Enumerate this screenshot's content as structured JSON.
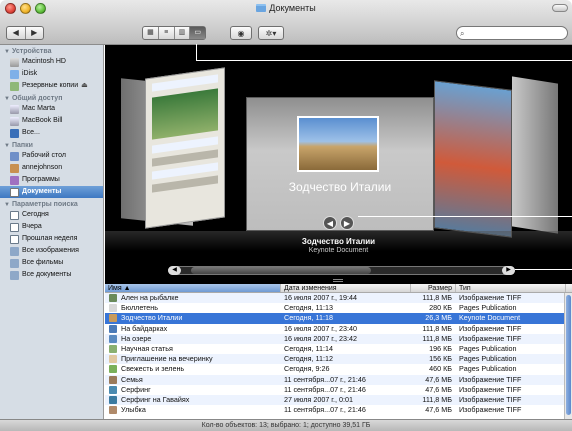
{
  "window": {
    "title": "Документы"
  },
  "toolbar": {
    "back": "◀",
    "forward": "▶",
    "views": [
      "▦",
      "≡",
      "▥",
      "▭"
    ],
    "eye": "◉",
    "gear": "✲▾",
    "search_placeholder": ""
  },
  "sidebar": {
    "sections": [
      {
        "title": "Устройства",
        "items": [
          {
            "label": "Macintosh HD",
            "icon": "hard-drive-icon"
          },
          {
            "label": "iDisk",
            "icon": "idisk-icon"
          },
          {
            "label": "Резервные копии",
            "icon": "time-machine-icon",
            "eject": "⏏"
          }
        ]
      },
      {
        "title": "Общий доступ",
        "items": [
          {
            "label": "Mac Marta",
            "icon": "computer-icon"
          },
          {
            "label": "MacBook Bill",
            "icon": "laptop-icon"
          },
          {
            "label": "Все...",
            "icon": "globe-icon"
          }
        ]
      },
      {
        "title": "Папки",
        "items": [
          {
            "label": "Рабочий стол",
            "icon": "desktop-icon"
          },
          {
            "label": "annejohnson",
            "icon": "home-icon"
          },
          {
            "label": "Программы",
            "icon": "applications-icon"
          },
          {
            "label": "Документы",
            "icon": "documents-icon",
            "selected": true
          }
        ]
      },
      {
        "title": "Параметры поиска",
        "items": [
          {
            "label": "Сегодня",
            "icon": "clock-icon"
          },
          {
            "label": "Вчера",
            "icon": "clock-icon"
          },
          {
            "label": "Прошлая неделя",
            "icon": "clock-icon"
          },
          {
            "label": "Все изображения",
            "icon": "smart-folder-icon"
          },
          {
            "label": "Все фильмы",
            "icon": "smart-folder-icon"
          },
          {
            "label": "Все документы",
            "icon": "smart-folder-icon"
          }
        ]
      }
    ]
  },
  "coverflow": {
    "center_title": "Зодчество Италии",
    "selected_name": "Зодчество Италии",
    "selected_kind": "Keynote Document",
    "prev": "◀",
    "next": "▶"
  },
  "list": {
    "columns": {
      "name": "Имя",
      "date": "Дата изменения",
      "size": "Размер",
      "type": "Тип"
    },
    "rows": [
      {
        "name": "Ален на рыбалке",
        "date": "16 июля 2007 г., 19:44",
        "size": "111,8 МБ",
        "type": "Изображение TIFF",
        "color": "#6a8a5a"
      },
      {
        "name": "Бюллетень",
        "date": "Сегодня, 11:13",
        "size": "280 КБ",
        "type": "Pages Publication",
        "color": "#d8d8d8"
      },
      {
        "name": "Зодчество Италии",
        "date": "Сегодня, 11:18",
        "size": "26,3 МБ",
        "type": "Keynote Document",
        "color": "#c89a5a",
        "selected": true
      },
      {
        "name": "На байдарках",
        "date": "16 июля 2007 г., 23:40",
        "size": "111,8 МБ",
        "type": "Изображение TIFF",
        "color": "#4a7ab8"
      },
      {
        "name": "На озере",
        "date": "16 июля 2007 г., 23:42",
        "size": "111,8 МБ",
        "type": "Изображение TIFF",
        "color": "#5a8ac0"
      },
      {
        "name": "Научная статья",
        "date": "Сегодня, 11:14",
        "size": "196 КБ",
        "type": "Pages Publication",
        "color": "#8ab070"
      },
      {
        "name": "Приглашение на вечеринку",
        "date": "Сегодня, 11:12",
        "size": "156 КБ",
        "type": "Pages Publication",
        "color": "#e0c8a0"
      },
      {
        "name": "Свежесть и зелень",
        "date": "Сегодня, 9:26",
        "size": "460 КБ",
        "type": "Pages Publication",
        "color": "#7ab05a"
      },
      {
        "name": "Семья",
        "date": "11 сентября...07 г., 21:46",
        "size": "47,6 МБ",
        "type": "Изображение TIFF",
        "color": "#9a7a5a"
      },
      {
        "name": "Серфинг",
        "date": "11 сентября...07 г., 21:46",
        "size": "47,6 МБ",
        "type": "Изображение TIFF",
        "color": "#4a8ab0"
      },
      {
        "name": "Серфинг на Гавайях",
        "date": "27 июля 2007 г., 0:01",
        "size": "111,8 МБ",
        "type": "Изображение TIFF",
        "color": "#3a7aa0"
      },
      {
        "name": "Улыбка",
        "date": "11 сентября...07 г., 21:46",
        "size": "47,6 МБ",
        "type": "Изображение TIFF",
        "color": "#b08a6a"
      }
    ]
  },
  "status": {
    "text": "Кол-во объектов: 13; выбрано: 1; доступно 39,51 ГБ"
  }
}
